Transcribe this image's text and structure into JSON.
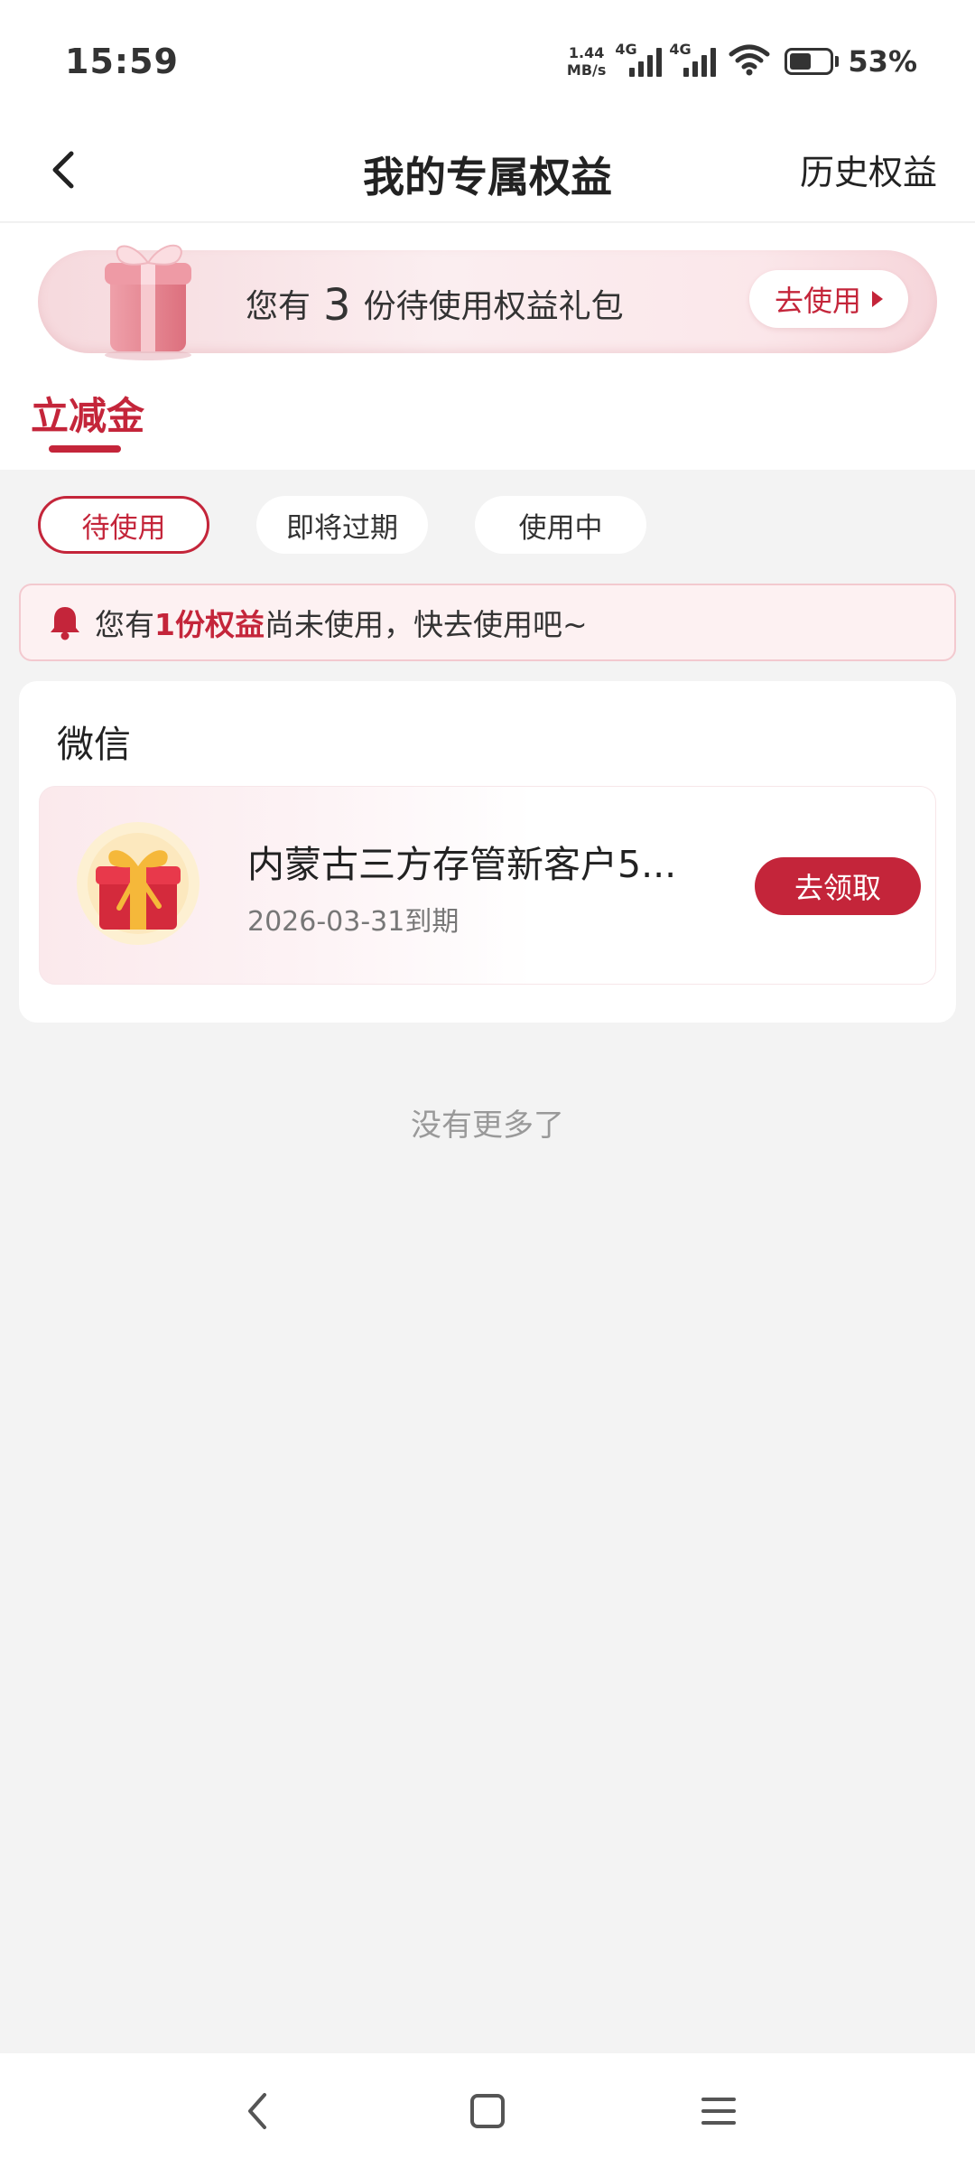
{
  "status_bar": {
    "time": "15:59",
    "net_speed_value": "1.44",
    "net_speed_unit": "MB/s",
    "signal_1_label": "4G",
    "signal_2_label": "4G",
    "wifi_icon": "wifi-icon",
    "battery_level": 0.53,
    "battery_percent": "53%"
  },
  "header": {
    "title": "我的专属权益",
    "history_link": "历史权益",
    "back_icon": "chevron-left-icon"
  },
  "banner": {
    "prefix": "您有",
    "count": "3",
    "suffix": "份待使用权益礼包",
    "button_label": "去使用",
    "icon": "gift-box-icon"
  },
  "category_tab": {
    "label": "立减金"
  },
  "filters": [
    {
      "label": "待使用",
      "active": true
    },
    {
      "label": "即将过期",
      "active": false
    },
    {
      "label": "使用中",
      "active": false
    }
  ],
  "notice": {
    "prefix": "您有",
    "highlight": "1份权益",
    "suffix": "尚未使用，快去使用吧~",
    "icon": "bell-icon"
  },
  "card": {
    "channel": "微信",
    "items": [
      {
        "name": "内蒙古三方存管新客户5...",
        "expire": "2026-03-31到期",
        "button_label": "去领取",
        "icon": "gift-icon"
      }
    ]
  },
  "footer": {
    "no_more": "没有更多了"
  },
  "nav_bar": {
    "back_icon": "nav-back-icon",
    "home_icon": "nav-home-icon",
    "menu_icon": "nav-menu-icon"
  },
  "colors": {
    "accent": "#c4253a",
    "background": "#f3f3f3"
  }
}
